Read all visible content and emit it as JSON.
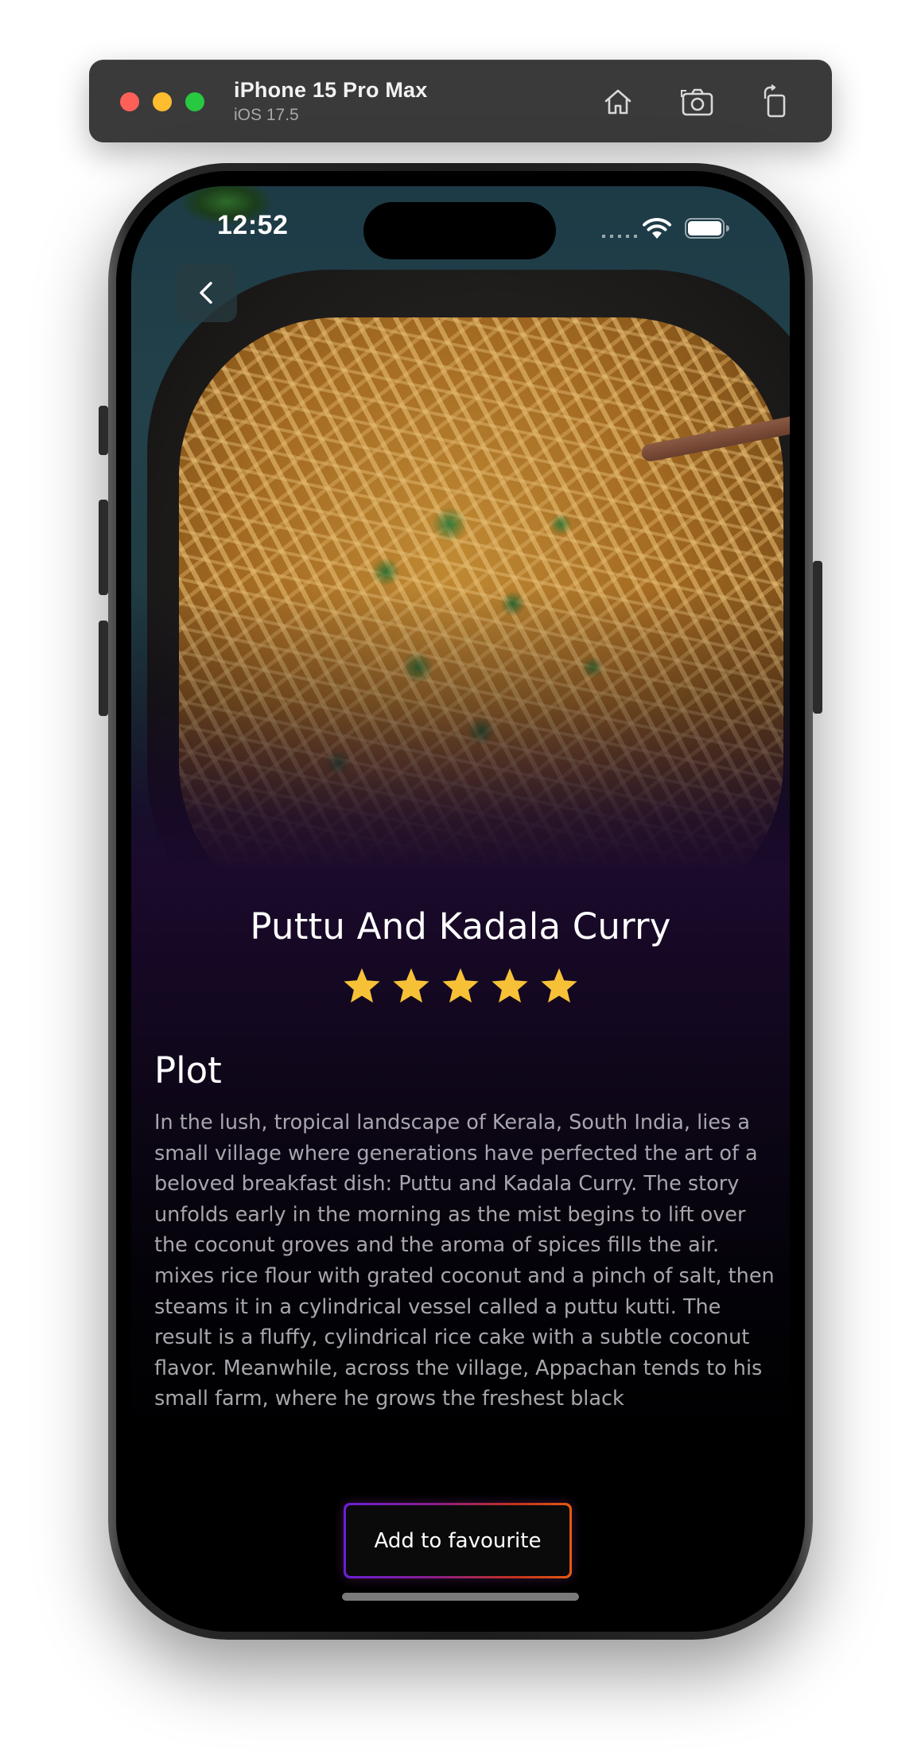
{
  "simulator": {
    "device_name": "iPhone 15 Pro Max",
    "os_version": "iOS 17.5",
    "icons": [
      "home-icon",
      "screenshot-icon",
      "rotate-icon"
    ]
  },
  "status_bar": {
    "time": "12:52",
    "icons": [
      "wifi-icon",
      "battery-icon"
    ]
  },
  "nav": {
    "back_icon": "chevron-left-icon"
  },
  "dish": {
    "title": "Puttu And Kadala Curry",
    "rating": 5,
    "rating_max": 5
  },
  "plot": {
    "heading": "Plot",
    "text": "In the lush, tropical landscape of Kerala, South India, lies a small village where generations have perfected the art of a beloved breakfast dish: Puttu and Kadala Curry. The story unfolds early in the morning as the mist begins to lift over the coconut groves and the aroma of spices fills the air. mixes rice flour with grated coconut and a pinch of salt, then steams it in a cylindrical vessel called a puttu kutti. The result is a fluffy, cylindrical rice cake with a subtle coconut flavor. Meanwhile, across the village, Appachan tends to his small farm, where he grows the freshest black"
  },
  "actions": {
    "add_favourite_label": "Add to favourite"
  },
  "colors": {
    "background_top": "#1b0a2c",
    "background_bottom": "#000000",
    "star": "#f7c137",
    "button_gradient_start": "#6a1fd6",
    "button_gradient_end": "#e35a12",
    "plot_text": "#a9a5ad"
  }
}
